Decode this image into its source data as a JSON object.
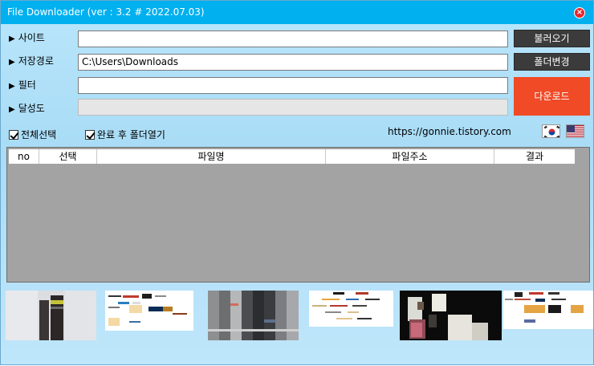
{
  "window": {
    "title": "File Downloader (ver : 3.2 # 2022.07.03)"
  },
  "rows": [
    {
      "label": "사이트",
      "value": ""
    },
    {
      "label": "저장경로",
      "value": "C:\\Users\\Downloads"
    },
    {
      "label": "필터",
      "value": ""
    },
    {
      "label": "달성도",
      "progress": 0
    }
  ],
  "buttons": {
    "load": "불러오기",
    "change_folder": "폴더변경",
    "download": "다운로드"
  },
  "checks": {
    "select_all": "전체선택",
    "open_folder": "완료 후 폴더열기"
  },
  "site_link": "https://gonnie.tistory.com",
  "table": {
    "columns": [
      "no",
      "선택",
      "파일명",
      "파일주소",
      "결과"
    ]
  },
  "colors": {
    "titlebar": "#00b0ef",
    "download_button": "#f04a26",
    "dark_button": "#3b3b3b"
  }
}
